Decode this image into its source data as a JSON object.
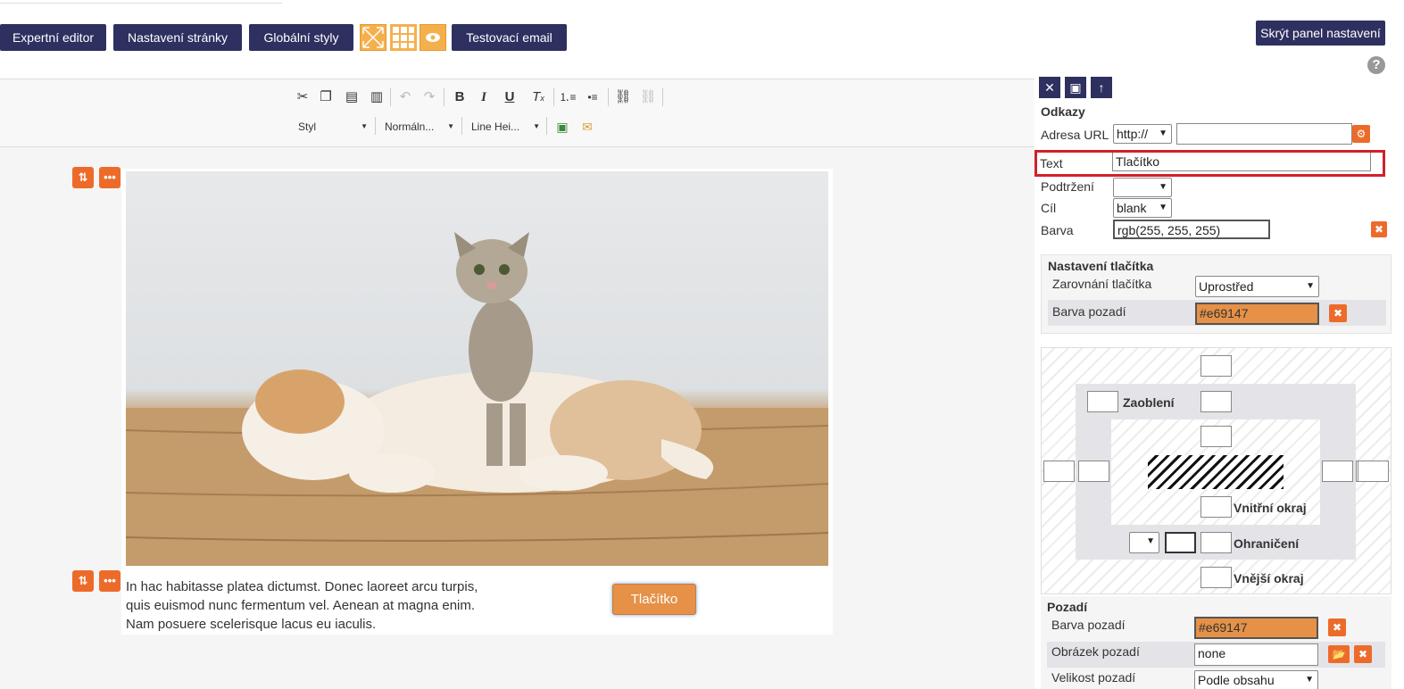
{
  "topbar": {
    "buttons": [
      "Expertní editor",
      "Nastavení stránky",
      "Globální styly",
      "Testovací email"
    ],
    "hide_panel": "Skrýt panel nastavení",
    "help": "?"
  },
  "toolbar": {
    "selects": [
      "Styl",
      "Normáln...",
      "Line Hei..."
    ]
  },
  "content": {
    "body_text": "In hac habitasse platea dictumst. Donec laoreet arcu turpis, quis euismod nunc fermentum vel. Aenean at magna enim. Nam posuere scelerisque lacus eu iaculis.",
    "button_label": "Tlačítko"
  },
  "panel": {
    "section_links": "Odkazy",
    "url_label": "Adresa URL",
    "url_protocol": "http://",
    "url_value": "",
    "text_label": "Text",
    "text_value": "Tlačítko",
    "underline_label": "Podtržení",
    "underline_value": "",
    "target_label": "Cíl",
    "target_value": "blank",
    "color_label": "Barva",
    "color_value": "rgb(255, 255, 255)",
    "button_settings_title": "Nastavení tlačítka",
    "align_label": "Zarovnání tlačítka",
    "align_value": "Uprostřed",
    "bg_color_label": "Barva pozadí",
    "bg_color_value": "#e69147",
    "box": {
      "radius": "Zaoblení",
      "padding": "Vnitřní okraj",
      "border": "Ohraničení",
      "margin": "Vnější okraj"
    },
    "background_title": "Pozadí",
    "bg2_color_label": "Barva pozadí",
    "bg2_color_value": "#e69147",
    "bg_image_label": "Obrázek pozadí",
    "bg_image_value": "none",
    "bg_size_label": "Velikost pozadí",
    "bg_size_value": "Podle obsahu"
  },
  "colors": {
    "navy": "#2e3060",
    "accent": "#e69147",
    "danger": "#ed6b2a",
    "highlight": "#d2202a"
  }
}
